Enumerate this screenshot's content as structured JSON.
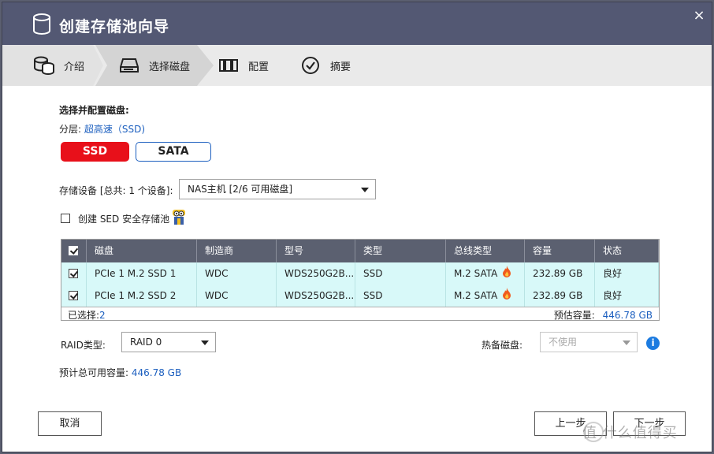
{
  "window": {
    "title": "创建存储池向导",
    "close_icon": "×"
  },
  "steps": [
    {
      "label": "介绍",
      "icon": "database-stack-icon"
    },
    {
      "label": "选择磁盘",
      "icon": "disk-drive-icon"
    },
    {
      "label": "配置",
      "icon": "raid-config-icon"
    },
    {
      "label": "摘要",
      "icon": "check-circle-icon"
    }
  ],
  "active_step": "选择磁盘",
  "section_title": "选择并配置磁盘:",
  "tier": {
    "label": "分层:",
    "value": "超高速（SSD)"
  },
  "tier_buttons": {
    "ssd": "SSD",
    "sata": "SATA"
  },
  "storage_device": {
    "label": "存储设备 [总共: 1 个设备]:",
    "value": "NAS主机 [2/6 可用磁盘]"
  },
  "sed": {
    "label": "创建 SED 安全存储池",
    "checked": false
  },
  "table": {
    "columns": [
      "磁盘",
      "制造商",
      "型号",
      "类型",
      "总线类型",
      "容量",
      "状态"
    ],
    "header_checked": true,
    "rows": [
      {
        "checked": true,
        "disk": "PCIe 1 M.2 SSD 1",
        "vendor": "WDC",
        "model": "WDS250G2B...",
        "type": "SSD",
        "bus": "M.2 SATA",
        "capacity": "232.89 GB",
        "status": "良好"
      },
      {
        "checked": true,
        "disk": "PCIe 1 M.2 SSD 2",
        "vendor": "WDC",
        "model": "WDS250G2B...",
        "type": "SSD",
        "bus": "M.2 SATA",
        "capacity": "232.89 GB",
        "status": "良好"
      }
    ],
    "footer": {
      "selected_label": "已选择:",
      "selected_count": "2",
      "est_label": "预估容量:",
      "est_value": "446.78 GB"
    }
  },
  "raid": {
    "label": "RAID类型:",
    "value": "RAID 0"
  },
  "hot_spare": {
    "label": "热备磁盘:",
    "value": "不使用"
  },
  "total_capacity": {
    "label": "预计总可用容量:",
    "value": "446.78 GB"
  },
  "buttons": {
    "cancel": "取消",
    "back": "上一步",
    "next": "下一步"
  },
  "watermark": "值 什么值得买",
  "colors": {
    "titlebar": "#535873",
    "ssd_active": "#e8101a",
    "row_selected": "#d8f9f9",
    "link_blue": "#1c5fbf"
  }
}
